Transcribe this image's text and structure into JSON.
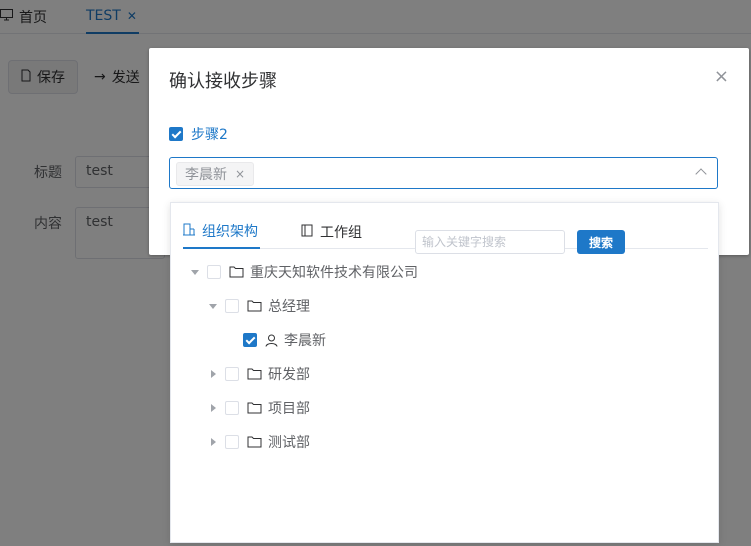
{
  "tabs": [
    {
      "label": "首页"
    },
    {
      "label": "TEST"
    }
  ],
  "toolbar": {
    "save_label": "保存",
    "send_label": "发送"
  },
  "form": {
    "title_label": "标题",
    "title_value": "test",
    "content_label": "内容",
    "content_value": "test"
  },
  "dialog": {
    "title": "确认接收步骤",
    "close_glyph": "×",
    "step_label": "步骤2",
    "selected_tag": "李晨新",
    "tag_close": "×"
  },
  "panel": {
    "tabs": [
      {
        "label": "组织架构"
      },
      {
        "label": "工作组"
      }
    ],
    "search_placeholder": "输入关键字搜索",
    "search_button": "搜索",
    "tree": [
      {
        "label": "重庆天知软件技术有限公司",
        "type": "folder",
        "expand": "down",
        "checked": false
      },
      {
        "label": "总经理",
        "type": "folder",
        "expand": "down",
        "checked": false
      },
      {
        "label": "李晨新",
        "type": "user",
        "expand": "none",
        "checked": true
      },
      {
        "label": "研发部",
        "type": "folder",
        "expand": "right",
        "checked": false
      },
      {
        "label": "项目部",
        "type": "folder",
        "expand": "right",
        "checked": false
      },
      {
        "label": "测试部",
        "type": "folder",
        "expand": "right",
        "checked": false
      }
    ]
  },
  "colors": {
    "accent": "#1e78c8",
    "mask": "rgba(0,0,0,0.5)"
  }
}
